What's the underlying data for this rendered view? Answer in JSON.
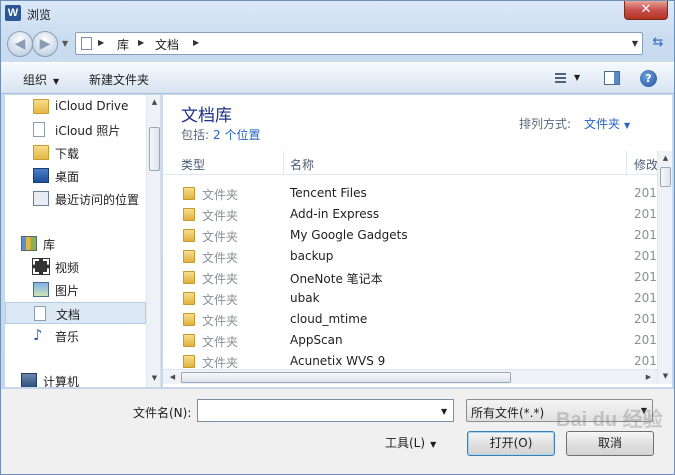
{
  "window": {
    "title": "浏览",
    "app_icon": "W",
    "close_glyph": "✕"
  },
  "nav": {
    "back_glyph": "◀",
    "forward_glyph": "▶",
    "breadcrumb": [
      "库",
      "文档"
    ],
    "refresh_glyph": "⇆"
  },
  "toolbar": {
    "organize_label": "组织",
    "new_folder_label": "新建文件夹",
    "help_glyph": "?"
  },
  "sidebar": {
    "items": [
      {
        "label": "iCloud Drive",
        "icon": "folder-icon"
      },
      {
        "label": "iCloud 照片",
        "icon": "page-icon"
      },
      {
        "label": "下载",
        "icon": "download-folder-icon"
      },
      {
        "label": "桌面",
        "icon": "desktop-icon"
      },
      {
        "label": "最近访问的位置",
        "icon": "recent-places-icon"
      },
      {
        "label": "库",
        "icon": "library-icon"
      },
      {
        "label": "视频",
        "icon": "video-icon"
      },
      {
        "label": "图片",
        "icon": "picture-icon"
      },
      {
        "label": "文档",
        "icon": "document-icon",
        "selected": true
      },
      {
        "label": "音乐",
        "icon": "music-icon",
        "glyph": "♪"
      },
      {
        "label": "计算机",
        "icon": "computer-icon"
      }
    ]
  },
  "library": {
    "title": "文档库",
    "includes_label": "包括:",
    "includes_link": "2 个位置",
    "arrange_label": "排列方式:",
    "arrange_value": "文件夹"
  },
  "columns": [
    "类型",
    "名称",
    "修改"
  ],
  "files": [
    {
      "type": "文件夹",
      "name": "Tencent Files",
      "date": "201"
    },
    {
      "type": "文件夹",
      "name": "Add-in Express",
      "date": "201"
    },
    {
      "type": "文件夹",
      "name": "My Google Gadgets",
      "date": "201"
    },
    {
      "type": "文件夹",
      "name": "backup",
      "date": "201"
    },
    {
      "type": "文件夹",
      "name": "OneNote 笔记本",
      "date": "201"
    },
    {
      "type": "文件夹",
      "name": "ubak",
      "date": "201"
    },
    {
      "type": "文件夹",
      "name": "cloud_mtime",
      "date": "201"
    },
    {
      "type": "文件夹",
      "name": "AppScan",
      "date": "201"
    },
    {
      "type": "文件夹",
      "name": "Acunetix WVS 9",
      "date": "201"
    }
  ],
  "bottom": {
    "filename_label": "文件名(N):",
    "filename_value": "",
    "filter_value": "所有文件(*.*)",
    "tools_label": "工具(L)",
    "open_label": "打开(O)",
    "cancel_label": "取消"
  },
  "watermark": "Bai du 经验",
  "colors": {
    "library_title": "#1e3287",
    "link": "#2166c1"
  }
}
